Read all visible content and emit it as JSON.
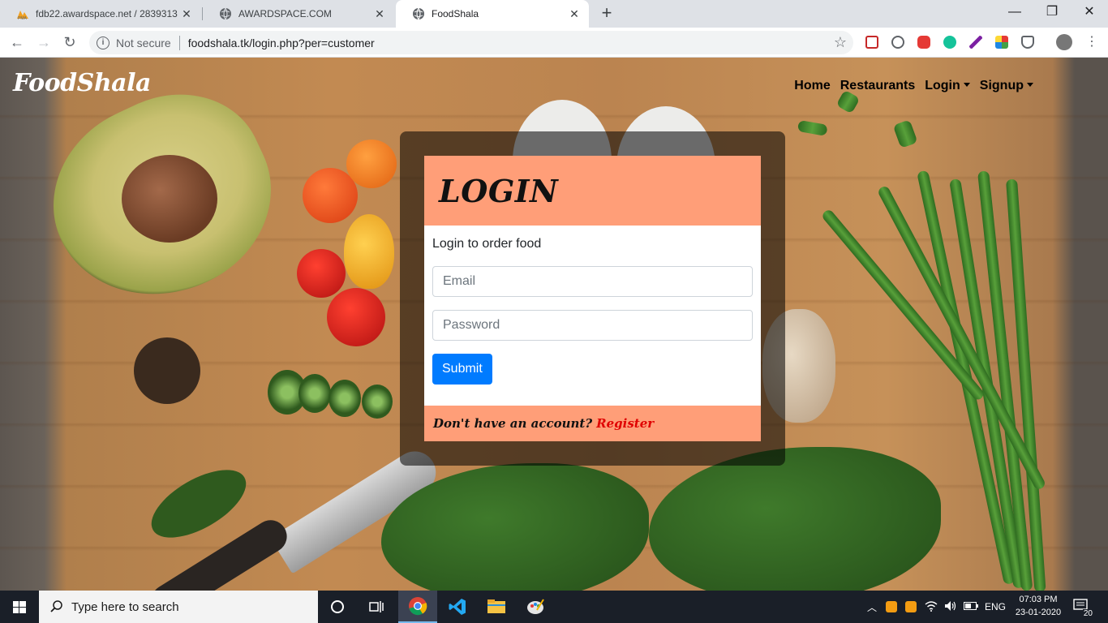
{
  "browser": {
    "tabs": [
      {
        "title": "fdb22.awardspace.net / 2839313",
        "active": false
      },
      {
        "title": "AWARDSPACE.COM",
        "active": false
      },
      {
        "title": "FoodShala",
        "active": true
      }
    ],
    "new_tab_label": "+",
    "window_controls": {
      "minimize": "—",
      "restore": "❐",
      "close": "✕"
    },
    "nav": {
      "back": "←",
      "forward": "→",
      "reload": "↻"
    },
    "security_label": "Not secure",
    "url": "foodshala.tk/login.php?per=customer",
    "star": "☆",
    "extension_colors": [
      "#c62828",
      "#5f6368",
      "#e53935",
      "#15c39a",
      "#7b1fa2",
      "#f9a825",
      "#5f6368"
    ]
  },
  "site": {
    "brand": "FoodShala",
    "nav": [
      {
        "label": "Home"
      },
      {
        "label": "Restaurants"
      },
      {
        "label": "Login",
        "dropdown": true
      },
      {
        "label": "Signup",
        "dropdown": true
      }
    ]
  },
  "login": {
    "heading": "LOGIN",
    "subtitle": "Login to order food",
    "email_placeholder": "Email",
    "password_placeholder": "Password",
    "submit_label": "Submit",
    "footer_text": "Don't have an account?",
    "register_label": "Register",
    "colors": {
      "header_bg": "#ff9e78",
      "submit_bg": "#007bff",
      "register": "#e00000"
    }
  },
  "taskbar": {
    "search_placeholder": "Type here to search",
    "tray": {
      "language": "ENG",
      "time": "07:03 PM",
      "date": "23-01-2020",
      "notifications": "20"
    }
  }
}
